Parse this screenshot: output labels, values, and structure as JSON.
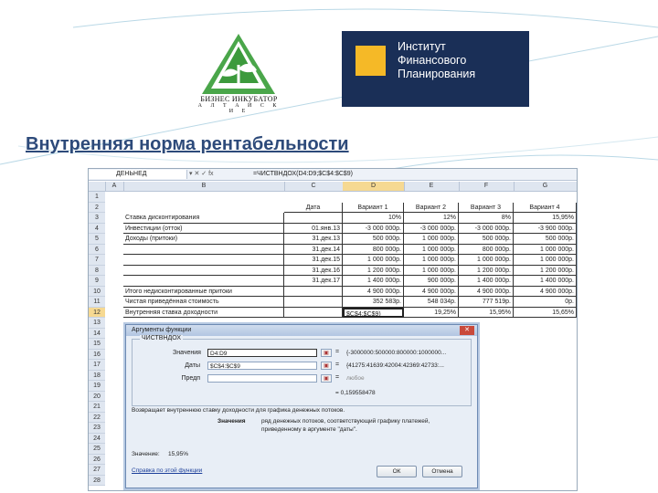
{
  "slide": {
    "title": "Внутренняя норма рентабельности",
    "logo_left": {
      "line1": "БИЗНЕС ИНКУБАТОР",
      "line2": "А Л Т А Й С К И Е"
    },
    "logo_right": {
      "line1": "Институт",
      "line2": "Финансового",
      "line3": "Планирования"
    },
    "colors": {
      "title": "#2d4a7a",
      "logo_right_bg": "#1a2f57",
      "logo_right_square": "#f5b927",
      "logo_left_green": "#3c9a3c"
    }
  },
  "spreadsheet": {
    "name_box": "ДЕНЬНЕД",
    "fx_buttons": "▾  ✕  ✓  fx",
    "formula": "=ЧИСТВНДОХ(D4:D9;$C$4:$C$9)",
    "columns": [
      "A",
      "B",
      "C",
      "D",
      "E",
      "F",
      "G"
    ],
    "rows": [
      "1",
      "2",
      "3",
      "4",
      "5",
      "6",
      "7",
      "8",
      "9",
      "10",
      "11",
      "12",
      "13",
      "14",
      "15",
      "16",
      "17",
      "18",
      "19",
      "20",
      "21",
      "22",
      "23",
      "24",
      "25",
      "26",
      "27",
      "28"
    ],
    "header": [
      "Дата",
      "Вариант 1",
      "Вариант 2",
      "Вариант 3",
      "Вариант 4"
    ],
    "labels": {
      "r3": "Ставка дисконтирования",
      "r4": "Инвестиции (отток)",
      "r5": "Доходы (притоки)",
      "r10": "Итого недисконтированные притоки",
      "r11": "Чистая приведённая стоимость",
      "r12": "Внутренняя ставка доходности"
    },
    "dates": [
      "01.янв.13",
      "31.дек.13",
      "31.дек.14",
      "31.дек.15",
      "31.дек.16",
      "31.дек.17"
    ],
    "rate_row": [
      "10%",
      "12%",
      "8%",
      "15,95%"
    ],
    "data_rows": [
      [
        "-3 000 000р.",
        "-3 000 000р.",
        "-3 000 000р.",
        "-3 900 000р."
      ],
      [
        "500 000р.",
        "1 000 000р.",
        "500 000р.",
        "500 000р."
      ],
      [
        "800 000р.",
        "1 000 000р.",
        "800 000р.",
        "1 000 000р."
      ],
      [
        "1 000 000р.",
        "1 000 000р.",
        "1 000 000р.",
        "1 000 000р."
      ],
      [
        "1 200 000р.",
        "1 000 000р.",
        "1 200 000р.",
        "1 200 000р."
      ],
      [
        "1 400 000р.",
        "900 000р.",
        "1 400 000р.",
        "1 400 000р."
      ]
    ],
    "total_row": [
      "4 900 000р.",
      "4 900 000р.",
      "4 900 000р.",
      "4 900 000р."
    ],
    "npv_row": [
      "352 583р.",
      "548 034р.",
      "777 519р.",
      "0р."
    ],
    "irr_row": [
      "$C$4:$C$9)",
      "19,25%",
      "15,95%",
      "15,65%"
    ]
  },
  "dialog": {
    "title": "Аргументы функции",
    "close": "✕",
    "function_name": "ЧИСТВНДОХ",
    "args": [
      {
        "label": "Значения",
        "input": "D4:D9",
        "value": "{-3000000:500000:800000:1000000..."
      },
      {
        "label": "Даты",
        "input": "$C$4:$C$9",
        "value": "{41275:41639:42004:42369:42733:..."
      },
      {
        "label": "Предп",
        "input": "",
        "value": "любое"
      }
    ],
    "result": "= 0,159558478",
    "description": "Возвращает внутреннюю ставку доходности для графика денежных потоков.",
    "param_name": "Значения",
    "param_desc_line1": "ряд денежных потоков, соответствующий графику платежей,",
    "param_desc_line2": "приведенному в аргументе \"даты\".",
    "value_label": "Значение:",
    "value_result": "15,95%",
    "help_link": "Справка по этой функции",
    "ok": "ОК",
    "cancel": "Отмена"
  }
}
